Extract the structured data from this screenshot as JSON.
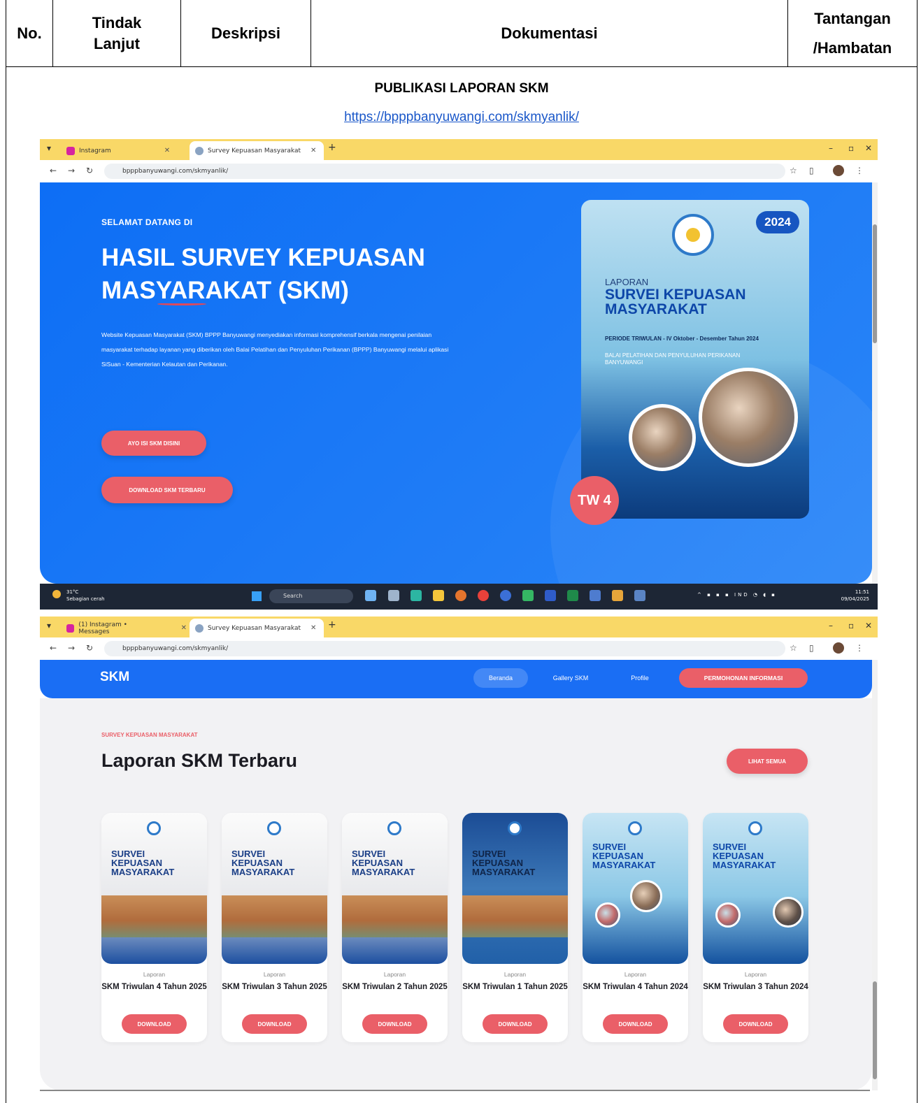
{
  "table": {
    "headers": [
      "No.",
      "Tindak Lanjut",
      "Deskripsi",
      "Dokumentasi",
      "Tantangan /Hambatan"
    ],
    "section_title": "PUBLIKASI LAPORAN SKM",
    "link": "https://bpppbanyuwangi.com/skmyanlik/"
  },
  "shot1": {
    "tabs": [
      "Instagram",
      "Survey Kepuasan Masyarakat"
    ],
    "url": "bpppbanyuwangi.com/skmyanlik/",
    "hero": {
      "welcome": "SELAMAT DATANG DI",
      "title": "HASIL SURVEY KEPUASAN MASYARAKAT (SKM)",
      "description": "Website Kepuasan Masyarakat (SKM) BPPP Banyuwangi menyediakan informasi komprehensif berkala mengenai penilaian masyarakat terhadap layanan yang diberikan oleh Balai Pelatihan dan Penyuluhan Perikanan (BPPP) Banyuwangi melalui aplikasi SiSuan - Kementerian Kelautan dan Perikanan.",
      "btn_fill": "AYO ISI SKM DISINI",
      "btn_download": "DOWNLOAD SKM TERBARU"
    },
    "cover": {
      "year": "2024",
      "label": "LAPORAN",
      "title": "SURVEI KEPUASAN MASYARAKAT",
      "period": "PERIODE TRIWULAN - IV Oktober - Desember Tahun 2024",
      "institution": "BALAI PELATIHAN DAN PENYULUHAN PERIKANAN BANYUWANGI",
      "badge": "TW 4"
    },
    "taskbar": {
      "weather": "31°C",
      "weather_desc": "Sebagian cerah",
      "search": "Search",
      "lang": "IND",
      "time": "11:51",
      "date": "09/04/2025"
    }
  },
  "shot2": {
    "tabs": [
      "(1) Instagram • Messages",
      "Survey Kepuasan Masyarakat"
    ],
    "url": "bpppbanyuwangi.com/skmyanlik/",
    "nav": {
      "logo": "SKM",
      "items": [
        "Beranda",
        "Gallery SKM",
        "Profile"
      ],
      "cta": "PERMOHONAN INFORMASI"
    },
    "eyebrow": "SURVEY KEPUASAN MASYARAKAT",
    "heading": "Laporan SKM Terbaru",
    "see_all": "LIHAT SEMUA",
    "cards": [
      {
        "label": "Laporan",
        "title": "SKM Triwulan 4 Tahun 2025",
        "button": "DOWNLOAD",
        "cover_text": "SURVEI KEPUASAN MASYARAKAT"
      },
      {
        "label": "Laporan",
        "title": "SKM Triwulan 3 Tahun 2025",
        "button": "DOWNLOAD",
        "cover_text": "SURVEI KEPUASAN MASYARAKAT"
      },
      {
        "label": "Laporan",
        "title": "SKM Triwulan 2 Tahun 2025",
        "button": "DOWNLOAD",
        "cover_text": "SURVEI KEPUASAN MASYARAKAT"
      },
      {
        "label": "Laporan",
        "title": "SKM Triwulan 1 Tahun 2025",
        "button": "DOWNLOAD",
        "cover_text": "SURVEI KEPUASAN MASYARAKAT"
      },
      {
        "label": "Laporan",
        "title": "SKM Triwulan 4 Tahun 2024",
        "button": "DOWNLOAD",
        "cover_text": "SURVEI KEPUASAN MASYARAKAT"
      },
      {
        "label": "Laporan",
        "title": "SKM Triwulan 3 Tahun 2024",
        "button": "DOWNLOAD",
        "cover_text": "SURVEI KEPUASAN MASYARAKAT"
      }
    ]
  },
  "colors": {
    "primary_blue": "#1a6ef4",
    "accent_red": "#ea5f68",
    "tab_yellow": "#f9d867",
    "link_blue": "#1a57c9"
  }
}
